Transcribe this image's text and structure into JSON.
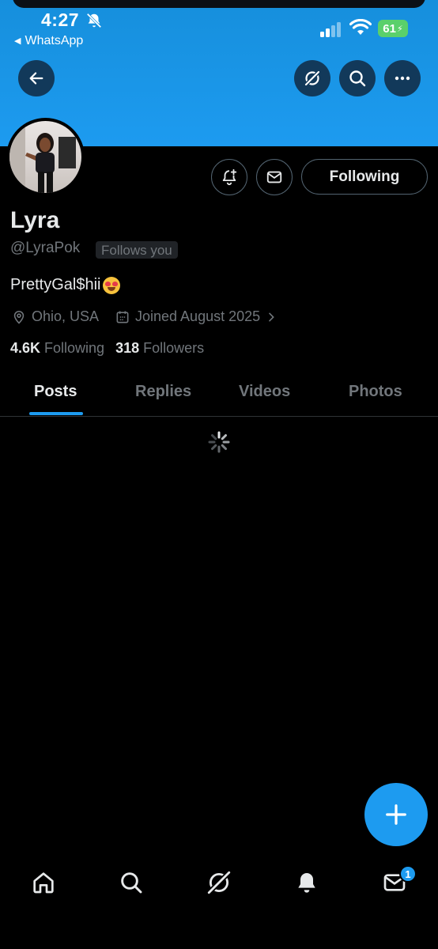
{
  "status_bar": {
    "time": "4:27",
    "back_app": "WhatsApp",
    "battery": "61"
  },
  "header": {
    "back_icon": "arrow-left-icon",
    "grok_icon": "grok-icon",
    "search_icon": "search-icon",
    "more_icon": "more-horizontal-icon"
  },
  "profile": {
    "name": "Lyra",
    "handle": "@LyraPok",
    "follows_you": "Follows you",
    "bio": "PrettyGal$hii",
    "location": "Ohio, USA",
    "joined": "Joined August 2025",
    "following_count": "4.6K",
    "following_label": "Following",
    "followers_count": "318",
    "followers_label": "Followers",
    "following_button": "Following"
  },
  "tabs": [
    {
      "label": "Posts",
      "active": true
    },
    {
      "label": "Replies",
      "active": false
    },
    {
      "label": "Videos",
      "active": false
    },
    {
      "label": "Photos",
      "active": false
    }
  ],
  "bottom_nav": {
    "items": [
      "home-icon",
      "search-icon",
      "grok-icon",
      "notifications-icon",
      "messages-icon"
    ],
    "messages_badge": "1"
  },
  "colors": {
    "accent": "#1d9bf0",
    "banner": "#1d9bf0",
    "background": "#000000",
    "muted_text": "#71767b"
  }
}
